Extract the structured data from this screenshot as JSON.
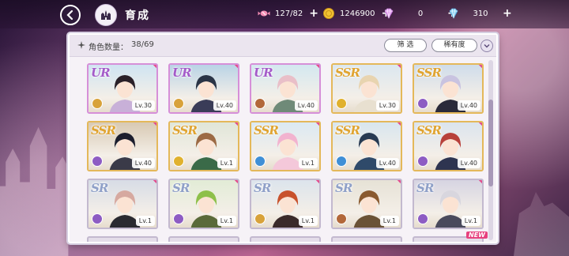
{
  "topbar": {
    "title": "育成",
    "back_icon": "back-arrow-icon",
    "home_icon": "home-castle-icon"
  },
  "resources": {
    "stamina": {
      "value": "127/82",
      "icon": "candy-icon",
      "plus": "+"
    },
    "gold": {
      "value": "1246900",
      "icon": "gold-coin-icon",
      "plus": "+"
    },
    "gem_a": {
      "value": "0",
      "icon": "pink-gem-icon",
      "plus": "+"
    },
    "gem_b": {
      "value": "310",
      "icon": "blue-gem-icon",
      "plus": "+"
    }
  },
  "panel": {
    "count_label": "角色数量：",
    "count_value": "38/69",
    "filter_label": "筛 选",
    "rarity_label": "稀有度",
    "new_badge": "NEW"
  },
  "cards": [
    {
      "rarity": "UR",
      "level": "Lv.30",
      "element": "#d8a23a",
      "hair": "#2a2028",
      "coat": "#c8b0d8",
      "sky": "#cfe4f2"
    },
    {
      "rarity": "UR",
      "level": "Lv.40",
      "element": "#d8a23a",
      "hair": "#2a3446",
      "coat": "#3a3c58",
      "sky": "#b9d3e6"
    },
    {
      "rarity": "UR",
      "level": "Lv.40",
      "element": "#b2683a",
      "hair": "#e9bfc8",
      "coat": "#6f8a78",
      "sky": "#d3e8f0"
    },
    {
      "rarity": "SSR",
      "level": "Lv.30",
      "element": "#e0b12e",
      "hair": "#e8d4b0",
      "coat": "#e8e0d0",
      "sky": "#dbe7f0"
    },
    {
      "rarity": "SSR",
      "level": "Lv.40",
      "element": "#8d5cc3",
      "hair": "#c9c3e0",
      "coat": "#2a2a3a",
      "sky": "#cfdcea"
    },
    {
      "rarity": "SSR",
      "level": "Lv.40",
      "element": "#8d5cc3",
      "hair": "#1c1e2e",
      "coat": "#3a3a48",
      "sky": "#d8c9b3"
    },
    {
      "rarity": "SSR",
      "level": "Lv.1",
      "element": "#e0b12e",
      "hair": "#9c6a44",
      "coat": "#3a6a48",
      "sky": "#e0e6d8"
    },
    {
      "rarity": "SSR",
      "level": "Lv.1",
      "element": "#3f8fd6",
      "hair": "#f2b3cf",
      "coat": "#f4c8da",
      "sky": "#dbe9f3"
    },
    {
      "rarity": "SSR",
      "level": "Lv.40",
      "element": "#3f8fd6",
      "hair": "#283a52",
      "coat": "#2f4a6a",
      "sky": "#d8e6ef"
    },
    {
      "rarity": "SSR",
      "level": "Lv.40",
      "element": "#8d5cc3",
      "hair": "#b8403a",
      "coat": "#2e3450",
      "sky": "#dbe4ee"
    },
    {
      "rarity": "SR",
      "level": "Lv.1",
      "element": "#8d5cc3",
      "hair": "#d6a9a0",
      "coat": "#2a2a30",
      "sky": "#d7dce6"
    },
    {
      "rarity": "SR",
      "level": "Lv.1",
      "element": "#8d5cc3",
      "hair": "#8ec04a",
      "coat": "#5a6a3a",
      "sky": "#e2ecd6"
    },
    {
      "rarity": "SR",
      "level": "Lv.1",
      "element": "#d8a23a",
      "hair": "#c8522c",
      "coat": "#3a2a2a",
      "sky": "#dce4ec"
    },
    {
      "rarity": "SR",
      "level": "Lv.1",
      "element": "#b2683a",
      "hair": "#8a5a30",
      "coat": "#6a5236",
      "sky": "#e6e2d6"
    },
    {
      "rarity": "SR",
      "level": "Lv.1",
      "element": "#8d5cc3",
      "hair": "#d8d6de",
      "coat": "#4a4a5c",
      "sky": "#d6d4e2"
    }
  ]
}
